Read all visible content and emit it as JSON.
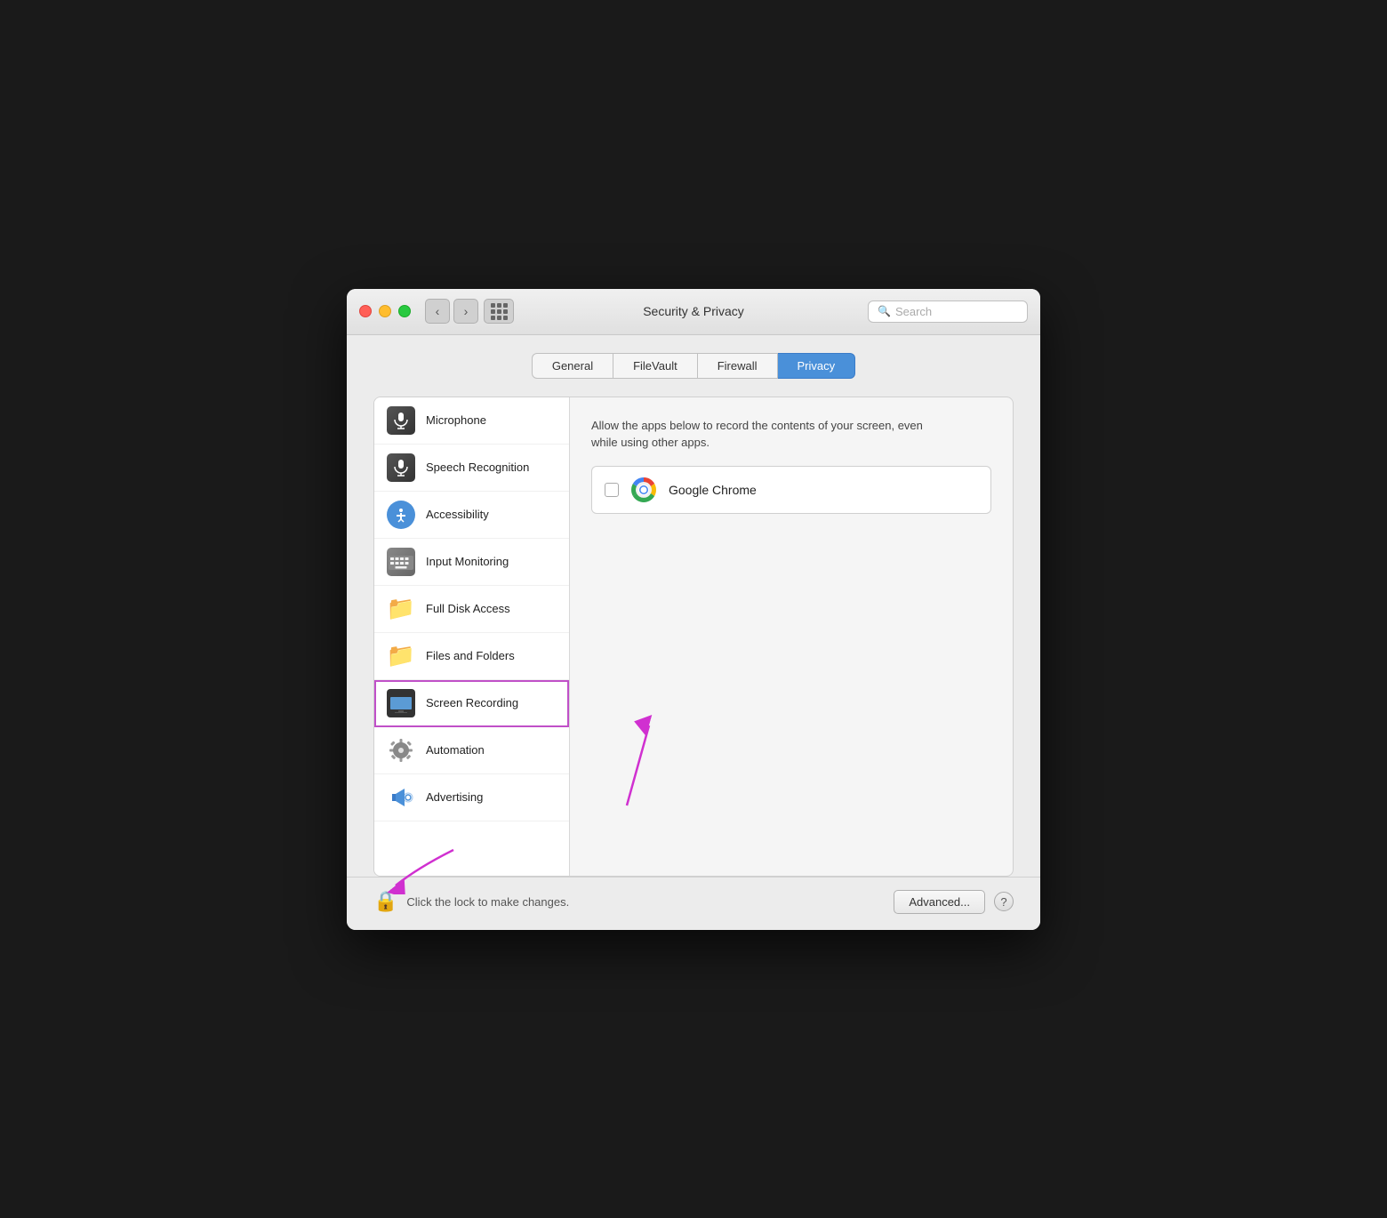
{
  "window": {
    "title": "Security & Privacy",
    "search_placeholder": "Search"
  },
  "tabs": [
    {
      "id": "general",
      "label": "General",
      "active": false
    },
    {
      "id": "filevault",
      "label": "FileVault",
      "active": false
    },
    {
      "id": "firewall",
      "label": "Firewall",
      "active": false
    },
    {
      "id": "privacy",
      "label": "Privacy",
      "active": true
    }
  ],
  "sidebar": {
    "items": [
      {
        "id": "microphone",
        "label": "Microphone",
        "icon": "microphone"
      },
      {
        "id": "speech",
        "label": "Speech Recognition",
        "icon": "speech"
      },
      {
        "id": "accessibility",
        "label": "Accessibility",
        "icon": "accessibility"
      },
      {
        "id": "input-monitoring",
        "label": "Input Monitoring",
        "icon": "keyboard"
      },
      {
        "id": "full-disk-access",
        "label": "Full Disk Access",
        "icon": "folder"
      },
      {
        "id": "files-folders",
        "label": "Files and Folders",
        "icon": "folder"
      },
      {
        "id": "screen-recording",
        "label": "Screen Recording",
        "icon": "screen",
        "selected": true
      },
      {
        "id": "automation",
        "label": "Automation",
        "icon": "gear"
      },
      {
        "id": "advertising",
        "label": "Advertising",
        "icon": "megaphone"
      }
    ]
  },
  "right_panel": {
    "description": "Allow the apps below to record the contents of your screen, even while using other apps.",
    "apps": [
      {
        "id": "chrome",
        "name": "Google Chrome",
        "checked": false
      }
    ]
  },
  "bottom": {
    "lock_text": "Click the lock to make changes.",
    "advanced_label": "Advanced...",
    "help_label": "?"
  }
}
